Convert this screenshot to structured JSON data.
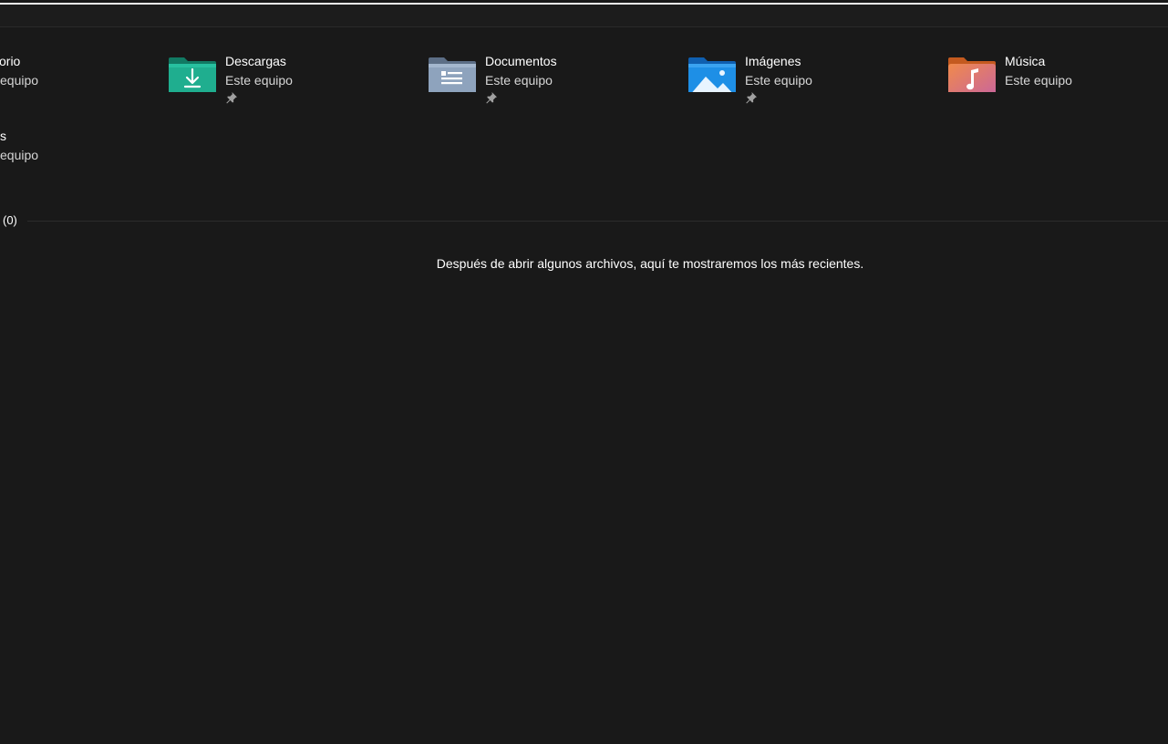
{
  "quick_access": {
    "partial_items": [
      {
        "title": "orio",
        "subtitle": "equipo"
      },
      {
        "title": "s",
        "subtitle": "equipo"
      }
    ],
    "items": [
      {
        "title": "Descargas",
        "subtitle": "Este equipo",
        "icon": "downloads-folder-icon",
        "pinned": true
      },
      {
        "title": "Documentos",
        "subtitle": "Este equipo",
        "icon": "documents-folder-icon",
        "pinned": true
      },
      {
        "title": "Imágenes",
        "subtitle": "Este equipo",
        "icon": "pictures-folder-icon",
        "pinned": true
      },
      {
        "title": "Música",
        "subtitle": "Este equipo",
        "icon": "music-folder-icon",
        "pinned": false
      }
    ]
  },
  "recent": {
    "header": "(0)",
    "empty_message": "Después de abrir algunos archivos, aquí te mostraremos los más recientes."
  },
  "colors": {
    "background": "#191919",
    "downloads": "#1fae8f",
    "documents": "#8ea3bd",
    "pictures": "#1e8fe6",
    "music": "#e8795a"
  }
}
